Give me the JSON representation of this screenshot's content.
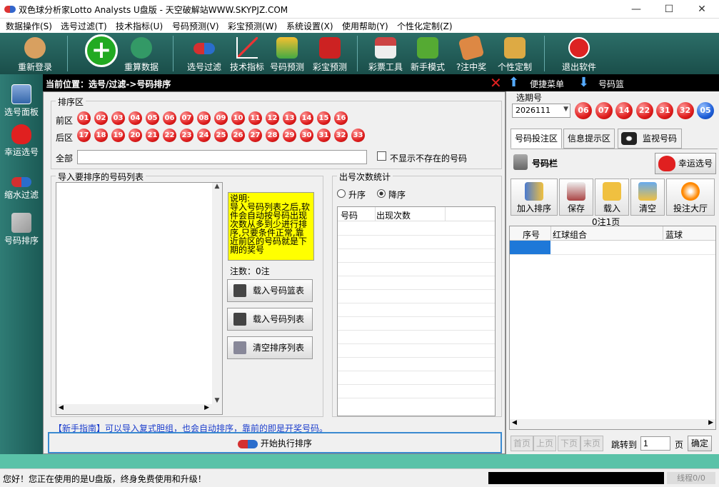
{
  "window": {
    "title": "双色球分析家Lotto Analysts U盘版 - 天空破解站WWW.SKYPJZ.COM",
    "minimize": "—",
    "maximize": "☐",
    "close": "✕"
  },
  "menu": [
    "数据操作(S)",
    "选号过滤(T)",
    "技术指标(U)",
    "号码预测(V)",
    "彩宝预测(W)",
    "系统设置(X)",
    "使用帮助(Y)",
    "个性化定制(Z)"
  ],
  "toolbar": [
    {
      "label": "重新登录",
      "icon": "user-icon",
      "color": "#d8a060"
    },
    {
      "label": "",
      "icon": "plus-icon",
      "color": "#22aa22"
    },
    {
      "label": "重算数据",
      "icon": "refresh-icon",
      "color": "#339966"
    },
    {
      "label": "选号过滤",
      "icon": "pill-icon",
      "color": "#d43030"
    },
    {
      "label": "技术指标",
      "icon": "chart-icon",
      "color": "#aa2222"
    },
    {
      "label": "号码预测",
      "icon": "predict-icon",
      "color": "#44aa44"
    },
    {
      "label": "彩宝预测",
      "icon": "treasure-icon",
      "color": "#cc2222"
    },
    {
      "label": "彩票工具",
      "icon": "store-icon",
      "color": "#cc4444"
    },
    {
      "label": "新手模式",
      "icon": "chat-icon",
      "color": "#55aa33"
    },
    {
      "label": "?注中奖",
      "icon": "prize-icon",
      "color": "#dd8844"
    },
    {
      "label": "个性定制",
      "icon": "clipboard-icon",
      "color": "#ddaa44"
    },
    {
      "label": "退出软件",
      "icon": "exit-icon",
      "color": "#dd2222"
    }
  ],
  "sidebar": [
    {
      "label": "选号面板",
      "icon": "panel-icon"
    },
    {
      "label": "幸运选号",
      "icon": "heart-icon"
    },
    {
      "label": "缩水过滤",
      "icon": "pill-icon"
    },
    {
      "label": "号码排序",
      "icon": "sort-icon"
    }
  ],
  "path": {
    "label": "当前位置：选号/过滤->号码排序",
    "shortcut": "便捷菜单",
    "basket": "号码篮"
  },
  "sort": {
    "group_label": "排序区",
    "front_label": "前区",
    "back_label": "后区",
    "front": [
      "01",
      "02",
      "03",
      "04",
      "05",
      "06",
      "07",
      "08",
      "09",
      "10",
      "11",
      "12",
      "13",
      "14",
      "15",
      "16"
    ],
    "back": [
      "17",
      "18",
      "19",
      "20",
      "21",
      "22",
      "23",
      "24",
      "25",
      "26",
      "27",
      "28",
      "29",
      "30",
      "31",
      "32",
      "33"
    ],
    "all_label": "全部",
    "hide_label": "不显示不存在的号码"
  },
  "import": {
    "group_label": "导入要排序的号码列表",
    "note": "说明:\n导入号码列表之后,软件会自动按号码出现次数从多到少进行排序,只要条件正常,靠近前区的号码就是下期的奖号",
    "count": "注数：0注",
    "load_basket": "载入号码篮表",
    "load_list": "载入号码列表",
    "clear": "清空排序列表"
  },
  "stats": {
    "group_label": "出号次数统计",
    "asc": "升序",
    "desc": "降序",
    "col1": "号码",
    "col2": "出现次数"
  },
  "guide": "【新手指南】可以导入复式胆组，也会自动排序，靠前的即是开奖号码。",
  "run_btn": "开始执行排序",
  "right": {
    "period_label": "选期号",
    "period": "2026111",
    "balls": [
      {
        "n": "06",
        "c": "red"
      },
      {
        "n": "07",
        "c": "red"
      },
      {
        "n": "14",
        "c": "red"
      },
      {
        "n": "22",
        "c": "red"
      },
      {
        "n": "31",
        "c": "red"
      },
      {
        "n": "32",
        "c": "red"
      },
      {
        "n": "05",
        "c": "blue"
      }
    ],
    "tabs": [
      "号码投注区",
      "信息提示区",
      "监视号码"
    ],
    "bar_label": "号码栏",
    "lucky": "幸运选号",
    "tools": [
      "加入排序",
      "保存",
      "载入",
      "清空",
      "投注大厅"
    ],
    "page_info": "0注1页",
    "cols": [
      "序号",
      "红球组合",
      "蓝球"
    ],
    "pager": [
      "首页",
      "上页",
      "下页",
      "末页"
    ],
    "jump_label": "跳转到",
    "jump_value": "1",
    "page_unit": "页",
    "confirm": "确定"
  },
  "status": {
    "text": "您好！您正在使用的是U盘版，终身免费使用和升级！",
    "threads": "线程0/0"
  }
}
